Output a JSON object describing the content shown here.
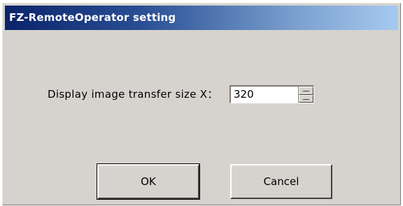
{
  "window": {
    "title": "FZ-RemoteOperator setting"
  },
  "form": {
    "label": "Display image transfer size X：",
    "value": "320"
  },
  "buttons": {
    "ok_label": "OK",
    "cancel_label": "Cancel"
  },
  "colors": {
    "dialog_background": "#d6d3ce",
    "titlebar_start": "#0a246a",
    "titlebar_end": "#a6caf0"
  },
  "icons": {
    "spin_up": "spin-up-icon",
    "spin_down": "spin-down-icon"
  }
}
